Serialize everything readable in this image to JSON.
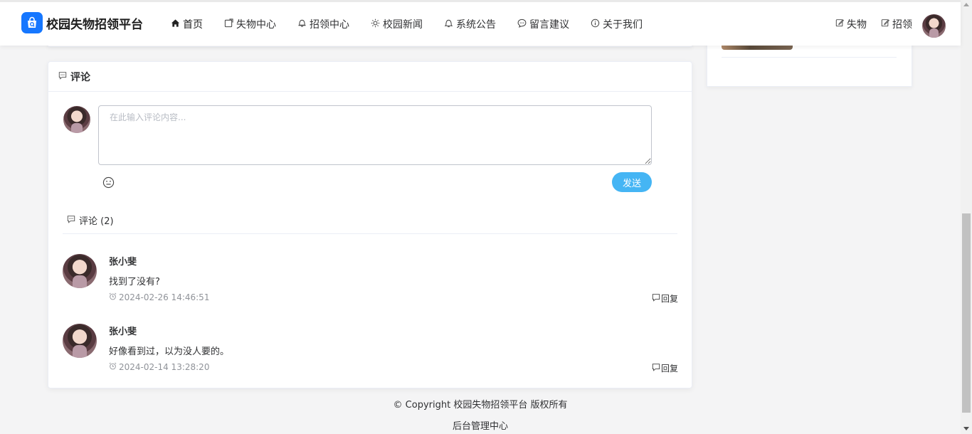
{
  "app": {
    "title": "校园失物招领平台",
    "accent_color": "#1677ff",
    "send_color": "#45b5f4"
  },
  "nav": {
    "items": [
      {
        "label": "首页",
        "icon": "home-icon"
      },
      {
        "label": "失物中心",
        "icon": "share-icon"
      },
      {
        "label": "招领中心",
        "icon": "bell-outline-icon"
      },
      {
        "label": "校园新闻",
        "icon": "sun-icon"
      },
      {
        "label": "系统公告",
        "icon": "bell-icon"
      },
      {
        "label": "留言建议",
        "icon": "chat-bubble-icon"
      },
      {
        "label": "关于我们",
        "icon": "info-icon"
      }
    ],
    "right": [
      {
        "label": "失物",
        "icon": "edit-icon"
      },
      {
        "label": "招领",
        "icon": "edit-icon"
      }
    ]
  },
  "comments": {
    "header": "评论",
    "placeholder": "在此输入评论内容...",
    "send_label": "发送",
    "list_title": "评论 (2)",
    "items": [
      {
        "name": "张小斐",
        "content": "找到了没有?",
        "time": "2024-02-26 14:46:51",
        "reply": "回复"
      },
      {
        "name": "张小斐",
        "content": "好像看到过，以为没人要的。",
        "time": "2024-02-14 13:28:20",
        "reply": "回复"
      }
    ]
  },
  "footer": {
    "copyright": "© Copyright 校园失物招领平台 版权所有",
    "admin": "后台管理中心"
  }
}
